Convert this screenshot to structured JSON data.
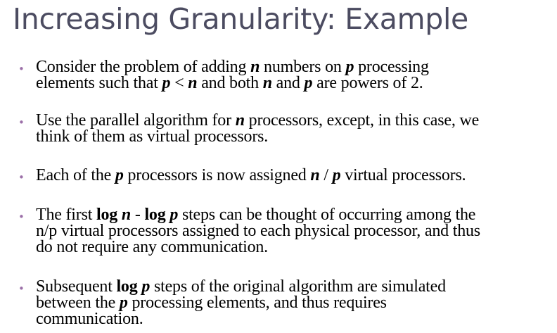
{
  "slide": {
    "title": "Increasing Granularity: Example",
    "bullet_marker": "•",
    "accent_color": "#9b6fa8",
    "title_color": "#4c4c61",
    "bullets": [
      {
        "lines": [
          [
            "Consider the problem of adding ",
            "n",
            " numbers on ",
            "p",
            " processing"
          ],
          [
            "elements such that ",
            "p",
            " < ",
            "n",
            " and both ",
            "n",
            " and ",
            "p",
            " are powers of 2."
          ]
        ]
      },
      {
        "lines": [
          [
            "Use the parallel algorithm for ",
            "n",
            " processors, except, in this case, we"
          ],
          [
            "think of them as virtual processors."
          ]
        ]
      },
      {
        "lines": [
          [
            "Each of the ",
            "p",
            " processors is now assigned ",
            "n",
            " / ",
            "p",
            " virtual processors."
          ]
        ]
      },
      {
        "lines": [
          [
            "The first ",
            "log",
            " ",
            "n",
            " - ",
            "log",
            " ",
            "p",
            " steps  can be thought of occurring among the"
          ],
          [
            "n/p virtual processors assigned to each physical processor, and thus"
          ],
          [
            "do not require any communication."
          ]
        ]
      },
      {
        "lines": [
          [
            "Subsequent ",
            "log",
            " ",
            "p",
            " steps of the original algorithm are simulated"
          ],
          [
            "between the ",
            "p",
            " processing elements, and thus requires"
          ],
          [
            "communication."
          ]
        ]
      }
    ]
  }
}
